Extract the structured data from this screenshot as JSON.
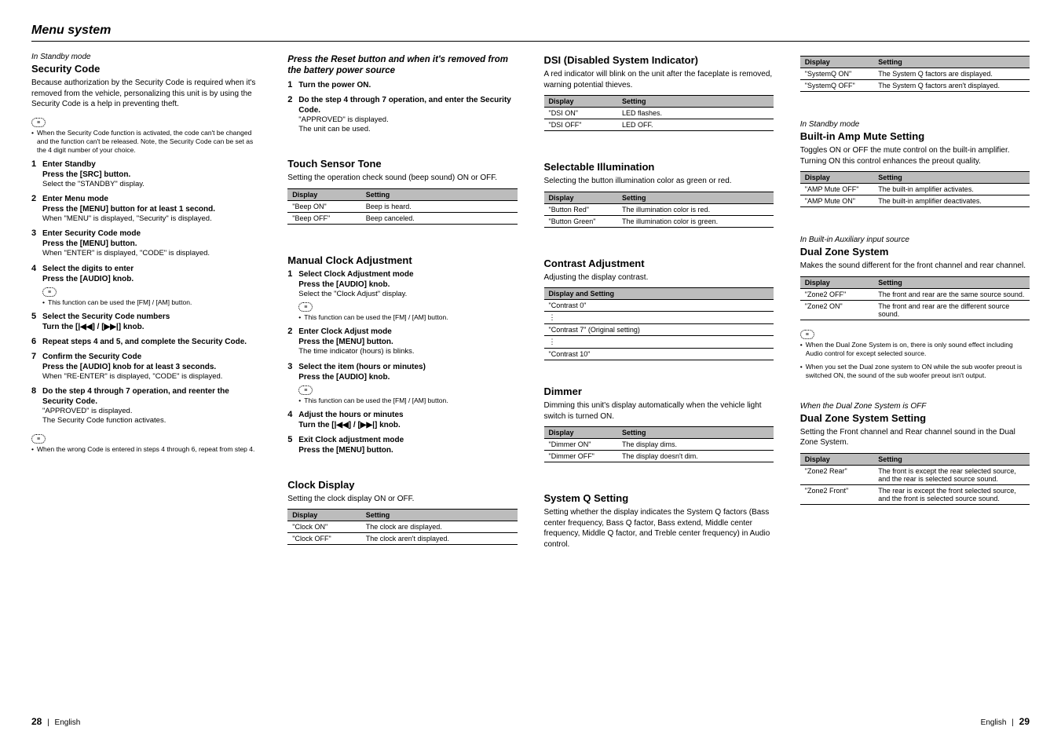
{
  "page_title": "Menu system",
  "footer": {
    "left_page": "28",
    "right_page": "29",
    "lang": "English"
  },
  "col1": {
    "sec1": {
      "context": "In Standby mode",
      "title": "Security Code",
      "desc": "Because authorization by the Security Code is required when it's removed from the vehicle, personalizing this unit is by using the Security Code is a help in preventing theft.",
      "note1": "When the Security Code function is activated, the code can't be changed and the function can't be released. Note, the Security Code can be set as the 4 digit number of your choice.",
      "steps": [
        {
          "t": "Enter Standby",
          "b": "Press the [SRC] button.",
          "s": "Select the \"STANDBY\" display."
        },
        {
          "t": "Enter Menu mode",
          "b": "Press the [MENU] button for at least 1 second.",
          "s": "When \"MENU\" is displayed, \"Security\" is displayed."
        },
        {
          "t": "Enter Security Code mode",
          "b": "Press the [MENU] button.",
          "s": "When \"ENTER\" is displayed, \"CODE\" is displayed."
        },
        {
          "t": "Select the digits to enter",
          "b": "Press the [AUDIO] knob.",
          "note": "This function can be used the [FM] / [AM] button."
        },
        {
          "t": "Select the Security Code numbers",
          "b": "Turn the [|◀◀] / [▶▶|] knob."
        },
        {
          "t": "Repeat steps 4 and 5, and complete the Security Code."
        },
        {
          "t": "Confirm the Security Code",
          "b": "Press the [AUDIO] knob for at least 3 seconds.",
          "s": "When \"RE-ENTER\" is displayed, \"CODE\" is displayed."
        },
        {
          "t": "Do the step 4 through 7 operation, and reenter the Security Code.",
          "s1": "\"APPROVED\" is displayed.",
          "s2": "The Security Code function activates."
        }
      ],
      "note2": "When the wrong Code is entered in steps 4 through 6, repeat from step 4."
    }
  },
  "col2": {
    "reset": {
      "title": "Press the Reset button and when it's removed from the battery power source",
      "steps": [
        {
          "t": "Turn the power ON."
        },
        {
          "t": "Do the step 4 through 7 operation, and enter the Security Code.",
          "s1": "\"APPROVED\" is displayed.",
          "s2": "The unit can be used."
        }
      ]
    },
    "touch": {
      "title": "Touch Sensor Tone",
      "desc": "Setting the operation check sound (beep sound) ON or OFF.",
      "table": {
        "h1": "Display",
        "h2": "Setting",
        "rows": [
          [
            "\"Beep ON\"",
            "Beep is heard."
          ],
          [
            "\"Beep OFF\"",
            "Beep canceled."
          ]
        ]
      }
    },
    "clockadj": {
      "title": "Manual Clock Adjustment",
      "steps": [
        {
          "t": "Select Clock Adjustment mode",
          "b": "Press the [AUDIO] knob.",
          "s": "Select the \"Clock Adjust\" display.",
          "note": "This function can be used the [FM] / [AM] button."
        },
        {
          "t": "Enter Clock Adjust mode",
          "b": "Press the [MENU] button.",
          "s": "The time indicator (hours) is blinks."
        },
        {
          "t": "Select the item (hours or minutes)",
          "b": "Press the [AUDIO] knob.",
          "note": "This function can be used the [FM] / [AM] button."
        },
        {
          "t": "Adjust the hours or minutes",
          "b": "Turn the [|◀◀] / [▶▶|] knob."
        },
        {
          "t": "Exit Clock adjustment mode",
          "b": "Press the [MENU] button."
        }
      ]
    },
    "clockdisp": {
      "title": "Clock Display",
      "desc": "Setting the clock display ON or OFF.",
      "table": {
        "h1": "Display",
        "h2": "Setting",
        "rows": [
          [
            "\"Clock ON\"",
            "The clock are displayed."
          ],
          [
            "\"Clock OFF\"",
            "The clock aren't displayed."
          ]
        ]
      }
    }
  },
  "col3": {
    "dsi": {
      "title": "DSI (Disabled System Indicator)",
      "desc": "A red indicator will blink on the unit after the faceplate is removed, warning potential thieves.",
      "table": {
        "h1": "Display",
        "h2": "Setting",
        "rows": [
          [
            "\"DSI ON\"",
            "LED flashes."
          ],
          [
            "\"DSI OFF\"",
            "LED OFF."
          ]
        ]
      }
    },
    "illum": {
      "title": "Selectable Illumination",
      "desc": "Selecting the button illumination color as green or red.",
      "table": {
        "h1": "Display",
        "h2": "Setting",
        "rows": [
          [
            "\"Button Red\"",
            "The illumination color is red."
          ],
          [
            "\"Button Green\"",
            "The illumination color is green."
          ]
        ]
      }
    },
    "contrast": {
      "title": "Contrast Adjustment",
      "desc": "Adjusting the display contrast.",
      "header": "Display and Setting",
      "r1": "\"Contrast 0\"",
      "r2": "\"Contrast 7\" (Original setting)",
      "r3": "\"Contrast 10\""
    },
    "dimmer": {
      "title": "Dimmer",
      "desc": "Dimming this unit's display automatically when the vehicle light switch is turned ON.",
      "table": {
        "h1": "Display",
        "h2": "Setting",
        "rows": [
          [
            "\"Dimmer ON\"",
            "The display dims."
          ],
          [
            "\"Dimmer OFF\"",
            "The display doesn't dim."
          ]
        ]
      }
    },
    "sysq": {
      "title": "System Q Setting",
      "desc": "Setting whether the display indicates the System Q factors (Bass center frequency, Bass Q factor, Bass extend, Middle center frequency, Middle Q factor, and Treble center frequency) in Audio control."
    }
  },
  "col4": {
    "sysq_table": {
      "h1": "Display",
      "h2": "Setting",
      "rows": [
        [
          "\"SystemQ ON\"",
          "The System Q factors are displayed."
        ],
        [
          "\"SystemQ OFF\"",
          "The System Q factors aren't displayed."
        ]
      ]
    },
    "ampmute": {
      "context": "In Standby mode",
      "title": "Built-in Amp Mute Setting",
      "desc": "Toggles ON or OFF the mute control on the built-in amplifier.\nTurning ON this control enhances the preout quality.",
      "table": {
        "h1": "Display",
        "h2": "Setting",
        "rows": [
          [
            "\"AMP Mute OFF\"",
            "The built-in amplifier activates."
          ],
          [
            "\"AMP Mute ON\"",
            "The built-in amplifier deactivates."
          ]
        ]
      }
    },
    "dualzone": {
      "context": "In Built-in Auxiliary input source",
      "title": "Dual Zone System",
      "desc": "Makes the sound different for the front channel and rear channel.",
      "table": {
        "h1": "Display",
        "h2": "Setting",
        "rows": [
          [
            "\"Zone2 OFF\"",
            "The front and rear are the same source sound."
          ],
          [
            "\"Zone2 ON\"",
            "The front and rear are the different source sound."
          ]
        ]
      },
      "note1": "When the Dual Zone System is on, there is only sound effect including Audio control for except selected source.",
      "note2": "When you set the Dual zone system to ON while the sub woofer preout is switched ON, the sound of the sub woofer preout isn't output."
    },
    "dzsetting": {
      "context": "When the Dual Zone System is OFF",
      "title": "Dual Zone System Setting",
      "desc": "Setting the Front channel and Rear channel sound in the Dual Zone System.",
      "table": {
        "h1": "Display",
        "h2": "Setting",
        "rows": [
          [
            "\"Zone2 Rear\"",
            "The front is except the rear selected source, and the rear is selected source sound."
          ],
          [
            "\"Zone2 Front\"",
            "The rear is except the front selected source, and the front is selected source sound."
          ]
        ]
      }
    }
  }
}
